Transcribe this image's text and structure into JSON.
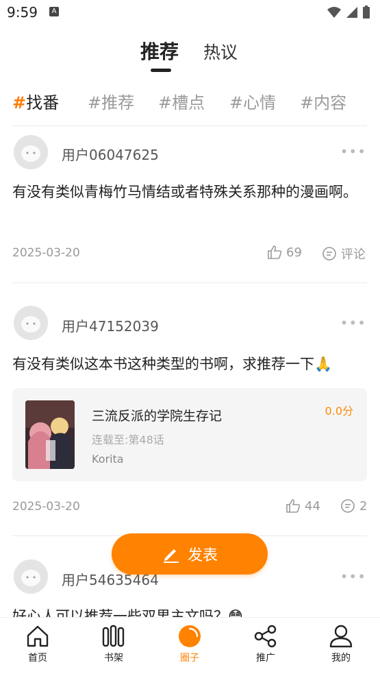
{
  "status_bar": {
    "time": "9:59",
    "notif_letter": "A"
  },
  "top_tabs": [
    {
      "label": "推荐",
      "active": true
    },
    {
      "label": "热议",
      "active": false
    }
  ],
  "topics": [
    {
      "hash": "#",
      "label": "找番",
      "active": true
    },
    {
      "hash": "#",
      "label": "推荐",
      "active": false
    },
    {
      "hash": "#",
      "label": "槽点",
      "active": false
    },
    {
      "hash": "#",
      "label": "心情",
      "active": false
    },
    {
      "hash": "#",
      "label": "内容",
      "active": false
    }
  ],
  "posts": [
    {
      "username": "用户06047625",
      "more": "•••",
      "content": "有没有类似青梅竹马情结或者特殊关系那种的漫画啊。",
      "date": "2025-03-20",
      "likes": "69",
      "comments": "评论"
    },
    {
      "username": "用户47152039",
      "more": "•••",
      "content": "有没有类似这本书这种类型的书啊，求推荐一下🙏",
      "book": {
        "title": "三流反派的学院生存记",
        "progress": "连载至:第48话",
        "author": "Korita",
        "score": "0.0分"
      },
      "date": "2025-03-20",
      "likes": "44",
      "comments": "2"
    },
    {
      "username": "用户54635464",
      "more": "•••",
      "content": "好心人可以推荐一些双男主文吗？😳"
    }
  ],
  "fab": {
    "label": "发表",
    "icon": "pen-icon"
  },
  "bottom_nav": [
    {
      "label": "首页",
      "icon": "home-icon",
      "active": false
    },
    {
      "label": "书架",
      "icon": "bookshelf-icon",
      "active": false
    },
    {
      "label": "圈子",
      "icon": "circle-icon",
      "active": true
    },
    {
      "label": "推广",
      "icon": "share-icon",
      "active": false
    },
    {
      "label": "我的",
      "icon": "profile-icon",
      "active": false
    }
  ],
  "colors": {
    "accent": "#ff8200",
    "muted": "#999999",
    "text": "#222222",
    "card": "#f5f5f6"
  }
}
